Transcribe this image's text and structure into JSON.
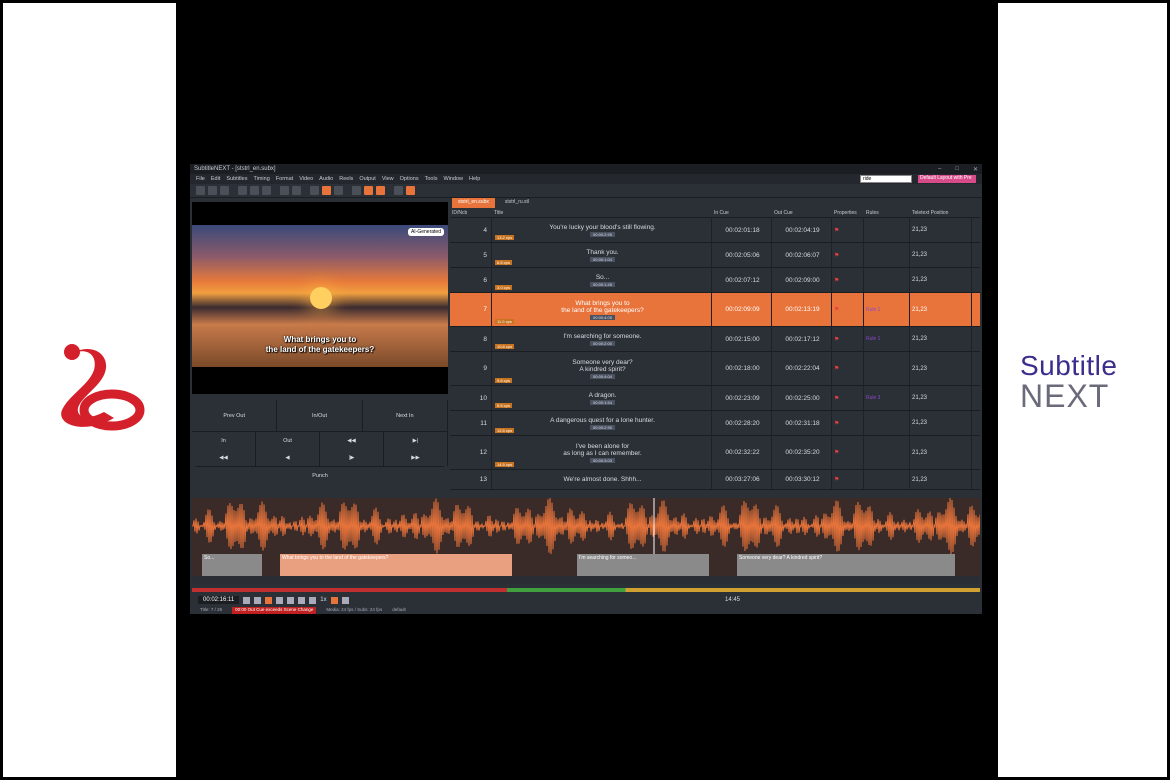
{
  "logos": {
    "left_alt": "IBC",
    "right_line1": "Subtitle",
    "right_line2": "NEXT"
  },
  "window": {
    "title": "SubtitleNEXT - [ststrl_en.subx]"
  },
  "menu": [
    "File",
    "Edit",
    "Subtitles",
    "Timing",
    "Format",
    "Video",
    "Audio",
    "Reels",
    "Output",
    "View",
    "Options",
    "Tools",
    "Window",
    "Help"
  ],
  "search": {
    "value": "ride"
  },
  "layout_select": "Default Layout with Pre",
  "tabs": [
    "ststrl_en.subx",
    "ststrl_ru.stl"
  ],
  "video": {
    "badge": "AI-Generated",
    "subtitle_line1": "What brings you to",
    "subtitle_line2": "the land of the gatekeepers?"
  },
  "controls": {
    "prev_out": "Prev Out",
    "in_out": "In/Out",
    "next_in": "Next In",
    "in": "In",
    "out": "Out",
    "punch": "Punch"
  },
  "grid": {
    "headers": {
      "id": "ID/Ncb",
      "title": "Title",
      "in": "In Cue",
      "out": "Out Cue",
      "props": "Properties",
      "rules": "Rules",
      "pos": "Teletext Position"
    },
    "rows": [
      {
        "id": "4",
        "line1": "You're lucky your blood's still flowing.",
        "line2": "",
        "cps": "13.2 cps",
        "dur": "00:00:2:95",
        "in": "00:02:01:18",
        "out": "00:02:04:19",
        "rule": "",
        "pos": "21,23",
        "sel": false
      },
      {
        "id": "5",
        "line1": "Thank you.",
        "line2": "",
        "cps": "6.6 cps",
        "dur": "00:00:1:04",
        "in": "00:02:05:06",
        "out": "00:02:06:07",
        "rule": "",
        "pos": "21,23",
        "sel": false
      },
      {
        "id": "6",
        "line1": "So...",
        "line2": "",
        "cps": "3.0 cps",
        "dur": "00:00:1:45",
        "in": "00:02:07:12",
        "out": "00:02:09:00",
        "rule": "",
        "pos": "21,23",
        "sel": false
      },
      {
        "id": "7",
        "line1": "What brings you to",
        "line2": "the land of the gatekeepers?",
        "cps": "11.0 cps",
        "dur": "00:00:4:05",
        "in": "00:02:09:09",
        "out": "00:02:13:19",
        "rule": "Rule 1",
        "pos": "21,23",
        "sel": true
      },
      {
        "id": "8",
        "line1": "I'm searching for someone.",
        "line2": "",
        "cps": "10.8 cps",
        "dur": "00:00:2:00",
        "in": "00:02:15:00",
        "out": "00:02:17:12",
        "rule": "Rule 1",
        "pos": "21,23",
        "sel": false
      },
      {
        "id": "9",
        "line1": "Someone very dear?",
        "line2": "A kindred spirit?",
        "cps": "9.6 cps",
        "dur": "00:00:4:04",
        "in": "00:02:18:00",
        "out": "00:02:22:04",
        "rule": "",
        "pos": "21,23",
        "sel": false
      },
      {
        "id": "10",
        "line1": "A dragon.",
        "line2": "",
        "cps": "5.5 cps",
        "dur": "00:00:1:54",
        "in": "00:02:23:09",
        "out": "00:02:25:00",
        "rule": "Rule 3",
        "pos": "21,23",
        "sel": false
      },
      {
        "id": "11",
        "line1": "A dangerous quest for a lone hunter.",
        "line2": "",
        "cps": "12.5 cps",
        "dur": "00:00:2:90",
        "in": "00:02:28:20",
        "out": "00:02:31:18",
        "rule": "",
        "pos": "21,23",
        "sel": false
      },
      {
        "id": "12",
        "line1": "I've been alone for",
        "line2": "as long as I can remember.",
        "cps": "14.5 cps",
        "dur": "00:00:3:03",
        "in": "00:02:32:22",
        "out": "00:02:35:20",
        "rule": "",
        "pos": "21,23",
        "sel": false
      },
      {
        "id": "13",
        "line1": "We're almost done. Shhh...",
        "line2": "",
        "cps": "",
        "dur": "",
        "in": "00:03:27:06",
        "out": "00:03:30:12",
        "rule": "",
        "pos": "21,23",
        "sel": false
      }
    ]
  },
  "waveform": {
    "segments": [
      {
        "id": "6",
        "text": "So..."
      },
      {
        "id": "7",
        "text": "What brings you to the land of the gatekeepers?"
      },
      {
        "id": "8",
        "text": "I'm searching for someo..."
      },
      {
        "id": "9",
        "text": "Someone very dear? A kindred spirit?"
      }
    ]
  },
  "transport": {
    "timecode": "00:02:16:11",
    "speed": "1x",
    "time_right": "14:45"
  },
  "statusbar": {
    "title": "Title: 7 / 26",
    "warning": "00:00 Out Cue exceeds Scene Change",
    "media": "Media: 24 fps / Subs: 24 fps",
    "preset": "default"
  }
}
